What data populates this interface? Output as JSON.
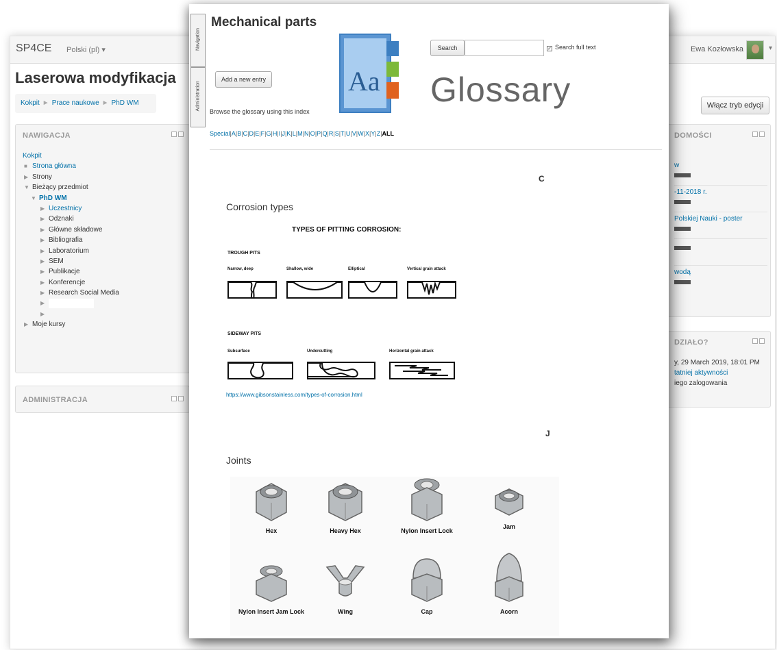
{
  "background": {
    "brand": "SP4CE",
    "language": "Polski (pl) ▾",
    "user_name": "Ewa Kozłowska",
    "user_caret": "▾",
    "course_title": "Laserowa modyfikacja",
    "breadcrumb": [
      "Kokpit",
      "Prace naukowe",
      "PhD WM"
    ],
    "breadcrumb_sep": "►",
    "edit_button": "Włącz tryb edycji",
    "nav_block": {
      "title": "NAWIGACJA",
      "items": [
        "Kokpit",
        "Strona główna",
        "Strony",
        "Bieżący przedmiot",
        "PhD WM",
        "Uczestnicy",
        "Odznaki",
        "Główne składowe",
        "Bibliografia",
        "Laboratorium",
        "SEM",
        "Publikacje",
        "Konferencje",
        "Research Social Media",
        "Moje kursy"
      ]
    },
    "admin_block": {
      "title": "ADMINISTRACJA"
    },
    "news_block": {
      "title": "DOMOŚCI",
      "items": [
        "w",
        "-11-2018 r.",
        "Polskiej Nauki - poster",
        "",
        "wodą"
      ]
    },
    "recent_block": {
      "title": "DZIAŁO?",
      "lines": [
        "y, 29 March 2019, 18:01 PM",
        "tatniej aktywności",
        "iego zalogowania"
      ]
    }
  },
  "glossary": {
    "side_tabs": [
      "Navigation",
      "Administration"
    ],
    "title": "Mechanical parts",
    "add_entry_button": "Add a new entry",
    "browse_text": "Browse the glossary using this index",
    "logo_text": "Aa",
    "logo_word": "Glossary",
    "search_button": "Search",
    "search_value": "",
    "search_fulltext_label": "Search full text",
    "alphabet": [
      "Special",
      "A",
      "B",
      "C",
      "D",
      "E",
      "F",
      "G",
      "H",
      "I",
      "J",
      "K",
      "L",
      "M",
      "N",
      "O",
      "P",
      "Q",
      "R",
      "S",
      "T",
      "U",
      "V",
      "W",
      "X",
      "Y",
      "Z"
    ],
    "alphabet_all": "ALL",
    "sections": [
      {
        "letter": "C",
        "entry_title": "Corrosion types",
        "figure_title": "TYPES OF PITTING CORROSION:",
        "trough_heading": "TROUGH PITS",
        "trough_pits": [
          "Narrow, deep",
          "Shallow, wide",
          "Elliptical",
          "Vertical grain attack"
        ],
        "sideway_heading": "SIDEWAY PITS",
        "sideway_pits": [
          "Subsurface",
          "Undercutting",
          "Horizontal grain attack"
        ],
        "link": "https://www.gibsonstainless.com/types-of-corrosion.html"
      },
      {
        "letter": "J",
        "entry_title": "Joints",
        "nuts": [
          "Hex",
          "Heavy Hex",
          "Nylon Insert Lock",
          "Jam",
          "Nylon Insert Jam Lock",
          "Wing",
          "Cap",
          "Acorn"
        ]
      }
    ]
  },
  "colors": {
    "link": "#0070a8",
    "logo_blue": "#3d7fc1",
    "logo_green": "#7cb93a",
    "logo_orange": "#e0621f"
  }
}
